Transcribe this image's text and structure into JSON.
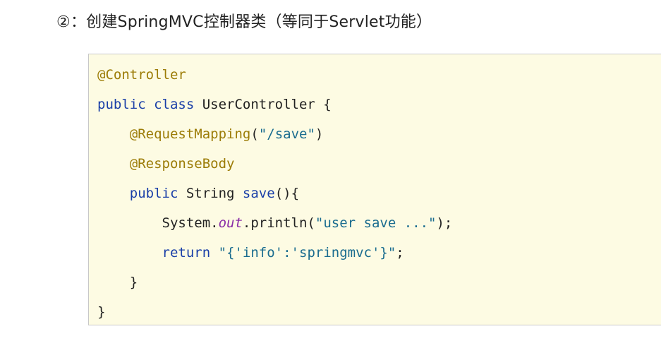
{
  "heading": {
    "marker": "②",
    "text": "：创建SpringMVC控制器类（等同于Servlet功能）"
  },
  "code": {
    "lines": [
      [
        {
          "text": "@Controller",
          "kind": "ann"
        }
      ],
      [
        {
          "text": "public class",
          "kind": "kw"
        },
        {
          "text": " UserController {",
          "kind": "plain"
        }
      ],
      [
        {
          "text": "    ",
          "kind": "plain"
        },
        {
          "text": "@RequestMapping",
          "kind": "ann"
        },
        {
          "text": "(",
          "kind": "plain"
        },
        {
          "text": "\"/save\"",
          "kind": "str"
        },
        {
          "text": ")",
          "kind": "plain"
        }
      ],
      [
        {
          "text": "    ",
          "kind": "plain"
        },
        {
          "text": "@ResponseBody",
          "kind": "ann"
        }
      ],
      [
        {
          "text": "    ",
          "kind": "plain"
        },
        {
          "text": "public",
          "kind": "kw"
        },
        {
          "text": " String ",
          "kind": "plain"
        },
        {
          "text": "save",
          "kind": "fn"
        },
        {
          "text": "(){",
          "kind": "plain"
        }
      ],
      [
        {
          "text": "        System.",
          "kind": "plain"
        },
        {
          "text": "out",
          "kind": "static"
        },
        {
          "text": ".println(",
          "kind": "plain"
        },
        {
          "text": "\"user save ...\"",
          "kind": "str"
        },
        {
          "text": ");",
          "kind": "plain"
        }
      ],
      [
        {
          "text": "        ",
          "kind": "plain"
        },
        {
          "text": "return",
          "kind": "kw"
        },
        {
          "text": " ",
          "kind": "plain"
        },
        {
          "text": "\"{'info':'springmvc'}\"",
          "kind": "str"
        },
        {
          "text": ";",
          "kind": "plain"
        }
      ],
      [
        {
          "text": "    }",
          "kind": "plain"
        }
      ],
      [
        {
          "text": "}",
          "kind": "plain"
        }
      ]
    ]
  }
}
